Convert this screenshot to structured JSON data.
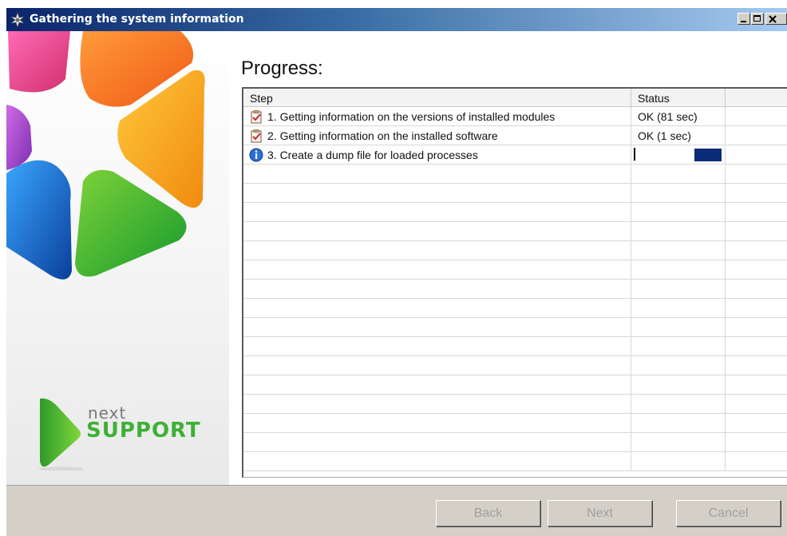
{
  "window": {
    "title": "Gathering the system information"
  },
  "brand": {
    "next": "next",
    "support": "SUPPORT"
  },
  "main": {
    "heading": "Progress:",
    "columns": [
      "Step",
      "Status",
      ""
    ],
    "rows": [
      {
        "icon": "clipboard-check-icon",
        "step": "1. Getting information on the versions of installed modules",
        "status": "OK (81 sec)"
      },
      {
        "icon": "clipboard-check-icon",
        "step": "2. Getting information on the installed software",
        "status": "OK (1 sec)"
      },
      {
        "icon": "info-icon",
        "step": "3. Create a dump file for loaded processes",
        "status": "",
        "progress": 0.3
      }
    ]
  },
  "buttons": {
    "back": "Back",
    "next": "Next",
    "cancel": "Cancel"
  },
  "colors": {
    "title_gradient_start": "#0a246a",
    "progress_fill": "#0b2a78",
    "brand_green": "#3db035"
  }
}
